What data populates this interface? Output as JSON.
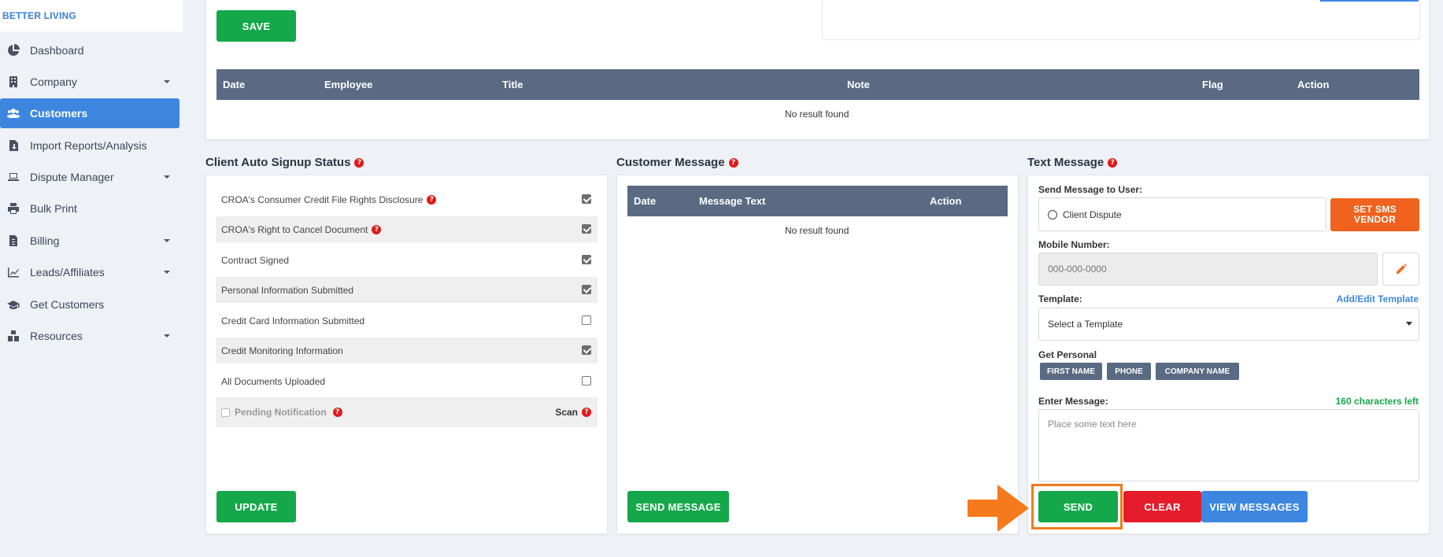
{
  "brand": "BETTER LIVING",
  "sidebar": {
    "items": [
      {
        "label": "Dashboard",
        "icon": "pie-chart-icon"
      },
      {
        "label": "Company",
        "icon": "building-icon"
      },
      {
        "label": "Customers",
        "icon": "users-icon"
      },
      {
        "label": "Import Reports/Analysis",
        "icon": "file-import-icon"
      },
      {
        "label": "Dispute Manager",
        "icon": "laptop-icon"
      },
      {
        "label": "Bulk Print",
        "icon": "printer-icon"
      },
      {
        "label": "Billing",
        "icon": "invoice-icon"
      },
      {
        "label": "Leads/Affiliates",
        "icon": "line-chart-icon"
      },
      {
        "label": "Get Customers",
        "icon": "graduation-cap-icon"
      },
      {
        "label": "Resources",
        "icon": "boxes-icon"
      }
    ]
  },
  "top_panel": {
    "save_label": "SAVE",
    "columns": [
      "Date",
      "Employee",
      "Title",
      "Note",
      "Flag",
      "Action"
    ],
    "empty_text": "No result found"
  },
  "signup_status": {
    "title": "Client Auto Signup Status",
    "rows": [
      {
        "label": "CROA's Consumer Credit File Rights Disclosure",
        "checked": true
      },
      {
        "label": "CROA's Right to Cancel Document",
        "checked": true
      },
      {
        "label": "Contract Signed",
        "checked": true
      },
      {
        "label": "Personal Information Submitted",
        "checked": true
      },
      {
        "label": "Credit Card Information Submitted",
        "checked": false
      },
      {
        "label": "Credit Monitoring Information",
        "checked": true
      },
      {
        "label": "All Documents Uploaded",
        "checked": false
      }
    ],
    "pending_label": "Pending Notification",
    "scan_label": "Scan",
    "update_label": "UPDATE"
  },
  "customer_message": {
    "title": "Customer Message",
    "columns": [
      "Date",
      "Message Text",
      "Action"
    ],
    "empty_text": "No result found",
    "send_label": "SEND MESSAGE"
  },
  "text_message": {
    "title": "Text Message",
    "send_to_label": "Send Message to User:",
    "send_to_value": "Client Dispute",
    "sms_vendor_label": "SET SMS VENDOR",
    "mobile_label": "Mobile Number:",
    "mobile_placeholder": "000-000-0000",
    "template_label": "Template:",
    "template_link": "Add/Edit Template",
    "template_value": "Select a Template",
    "personal_label": "Get Personal",
    "tags": [
      "FIRST NAME",
      "PHONE",
      "COMPANY NAME"
    ],
    "enter_label": "Enter Message:",
    "chars_left": "160 characters left",
    "message_placeholder": "Place some text here",
    "send_label": "SEND",
    "clear_label": "CLEAR",
    "view_label": "VIEW MESSAGES"
  },
  "colors": {
    "accent": "#3d86e0",
    "success": "#15a84b",
    "danger": "#e51d2a",
    "warning": "#f0621e",
    "highlight": "#f07a1c"
  }
}
